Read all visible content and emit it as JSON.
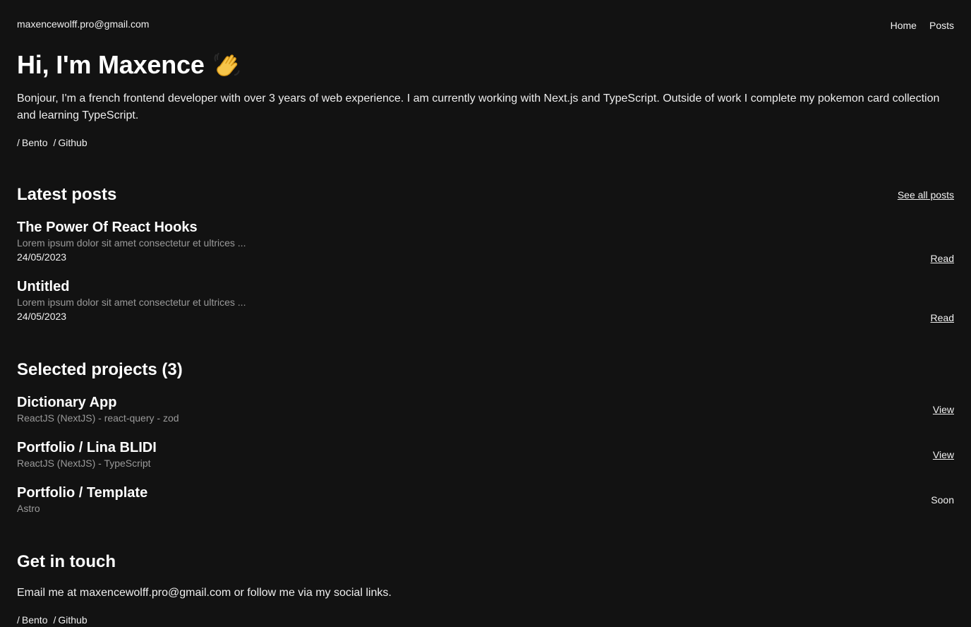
{
  "header": {
    "email": "maxencewolff.pro@gmail.com",
    "nav": [
      {
        "label": "Home"
      },
      {
        "label": "Posts"
      }
    ]
  },
  "hero": {
    "title": "Hi, I'm Maxence",
    "icon": "waving-hand-icon",
    "intro": "Bonjour, I'm a french frontend developer with over 3 years of web experience. I am currently working with Next.js and TypeScript. Outside of work I complete my pokemon card collection and learning TypeScript."
  },
  "social_links_top": [
    {
      "prefix": "/",
      "label": "Bento"
    },
    {
      "prefix": "/",
      "label": "Github"
    }
  ],
  "latest_posts": {
    "title": "Latest posts",
    "see_all": "See all posts",
    "items": [
      {
        "title": "The Power Of React Hooks",
        "excerpt": "Lorem ipsum dolor sit amet consectetur et ultrices ...",
        "date": "24/05/2023",
        "action": "Read"
      },
      {
        "title": "Untitled",
        "excerpt": "Lorem ipsum dolor sit amet consectetur et ultrices ...",
        "date": "24/05/2023",
        "action": "Read"
      }
    ]
  },
  "projects": {
    "title": "Selected projects (3)",
    "items": [
      {
        "title": "Dictionary App",
        "meta": "ReactJS (NextJS) - react-query - zod",
        "action": "View"
      },
      {
        "title": "Portfolio / Lina BLIDI",
        "meta": "ReactJS (NextJS) - TypeScript",
        "action": "View"
      },
      {
        "title": "Portfolio / Template",
        "meta": "Astro",
        "action": "Soon"
      }
    ]
  },
  "contact": {
    "title": "Get in touch",
    "text": "Email me at maxencewolff.pro@gmail.com or follow me via my social links."
  },
  "social_links_bottom": [
    {
      "prefix": "/",
      "label": "Bento"
    },
    {
      "prefix": "/",
      "label": "Github"
    }
  ]
}
